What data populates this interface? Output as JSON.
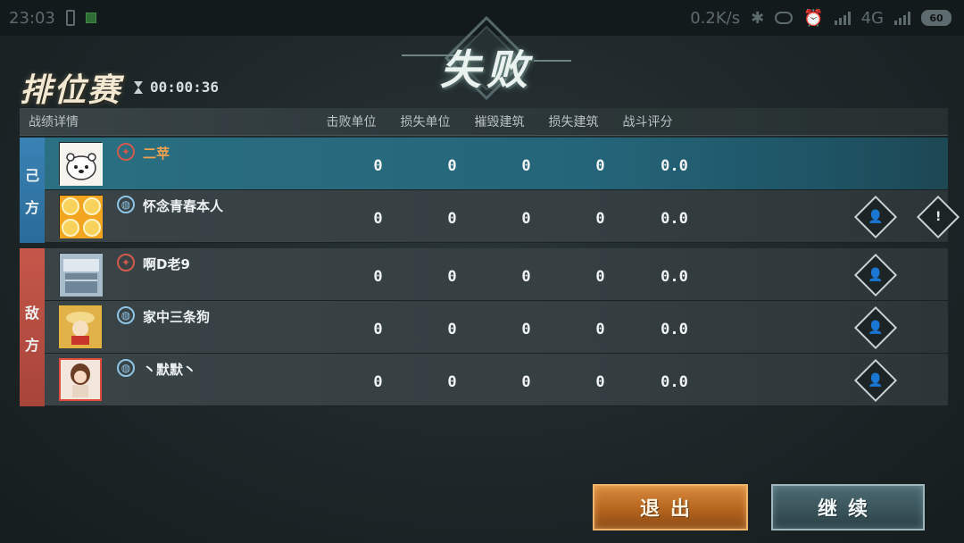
{
  "status_bar": {
    "time": "23:03",
    "net_speed": "0.2K/s",
    "network": "4G",
    "battery": "60"
  },
  "result": {
    "title": "失败"
  },
  "mode": {
    "title": "排位赛",
    "timer": "00:00:36"
  },
  "table": {
    "title": "战绩详情",
    "columns": [
      "击败单位",
      "损失单位",
      "摧毁建筑",
      "损失建筑",
      "战斗评分"
    ]
  },
  "teams": [
    {
      "label_top": "己",
      "label_bottom": "方",
      "color": "#3a82b5",
      "players": [
        {
          "name": "二苹",
          "rank_icon": "red-helmet-icon",
          "self": true,
          "kills": "0",
          "losses": "0",
          "destroyed": "0",
          "lost_buildings": "0",
          "score": "0.0",
          "actions": []
        },
        {
          "name": "怀念青春本人",
          "rank_icon": "blue-globe-icon",
          "self": false,
          "kills": "0",
          "losses": "0",
          "destroyed": "0",
          "lost_buildings": "0",
          "score": "0.0",
          "actions": [
            "add-friend-icon",
            "report-icon"
          ]
        }
      ]
    },
    {
      "label_top": "敌",
      "label_bottom": "方",
      "color": "#c4574a",
      "players": [
        {
          "name": "啊D老9",
          "rank_icon": "red-helmet-icon",
          "self": false,
          "kills": "0",
          "losses": "0",
          "destroyed": "0",
          "lost_buildings": "0",
          "score": "0.0",
          "actions": [
            "add-friend-icon"
          ]
        },
        {
          "name": "家中三条狗",
          "rank_icon": "blue-globe-icon",
          "self": false,
          "kills": "0",
          "losses": "0",
          "destroyed": "0",
          "lost_buildings": "0",
          "score": "0.0",
          "actions": [
            "add-friend-icon"
          ]
        },
        {
          "name": "丶默默丶",
          "rank_icon": "blue-globe-icon",
          "self": false,
          "kills": "0",
          "losses": "0",
          "destroyed": "0",
          "lost_buildings": "0",
          "score": "0.0",
          "actions": [
            "add-friend-icon"
          ]
        }
      ]
    }
  ],
  "buttons": {
    "exit": "退出",
    "continue": "继续"
  }
}
